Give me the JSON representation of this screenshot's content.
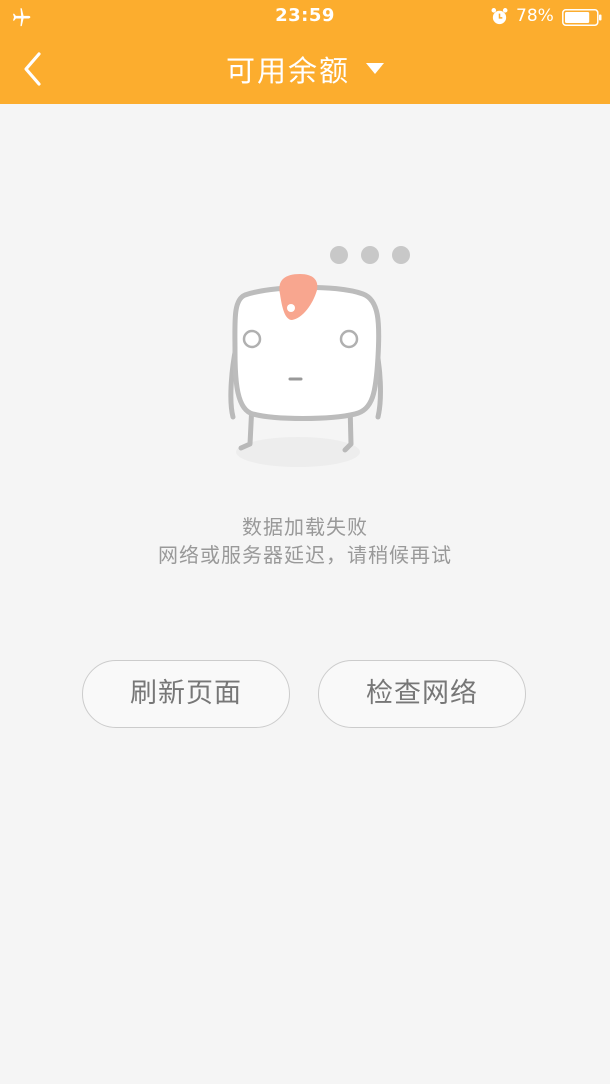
{
  "status_bar": {
    "time": "23:59",
    "battery_percent": "78%",
    "battery_level": 0.78,
    "icons": [
      "airplane-icon",
      "alarm-icon",
      "battery-icon"
    ]
  },
  "nav": {
    "title": "可用余额",
    "back_icon": "chevron-left-icon",
    "title_dropdown_icon": "caret-down-icon"
  },
  "error": {
    "title": "数据加载失败",
    "message": "网络或服务器延迟，请稍候再试"
  },
  "actions": {
    "refresh_label": "刷新页面",
    "check_network_label": "检查网络"
  },
  "colors": {
    "header": "#fcad2e",
    "background": "#f5f5f5",
    "text_muted": "#999999",
    "button_text": "#777777",
    "mascot_tuft": "#f8a68f"
  }
}
